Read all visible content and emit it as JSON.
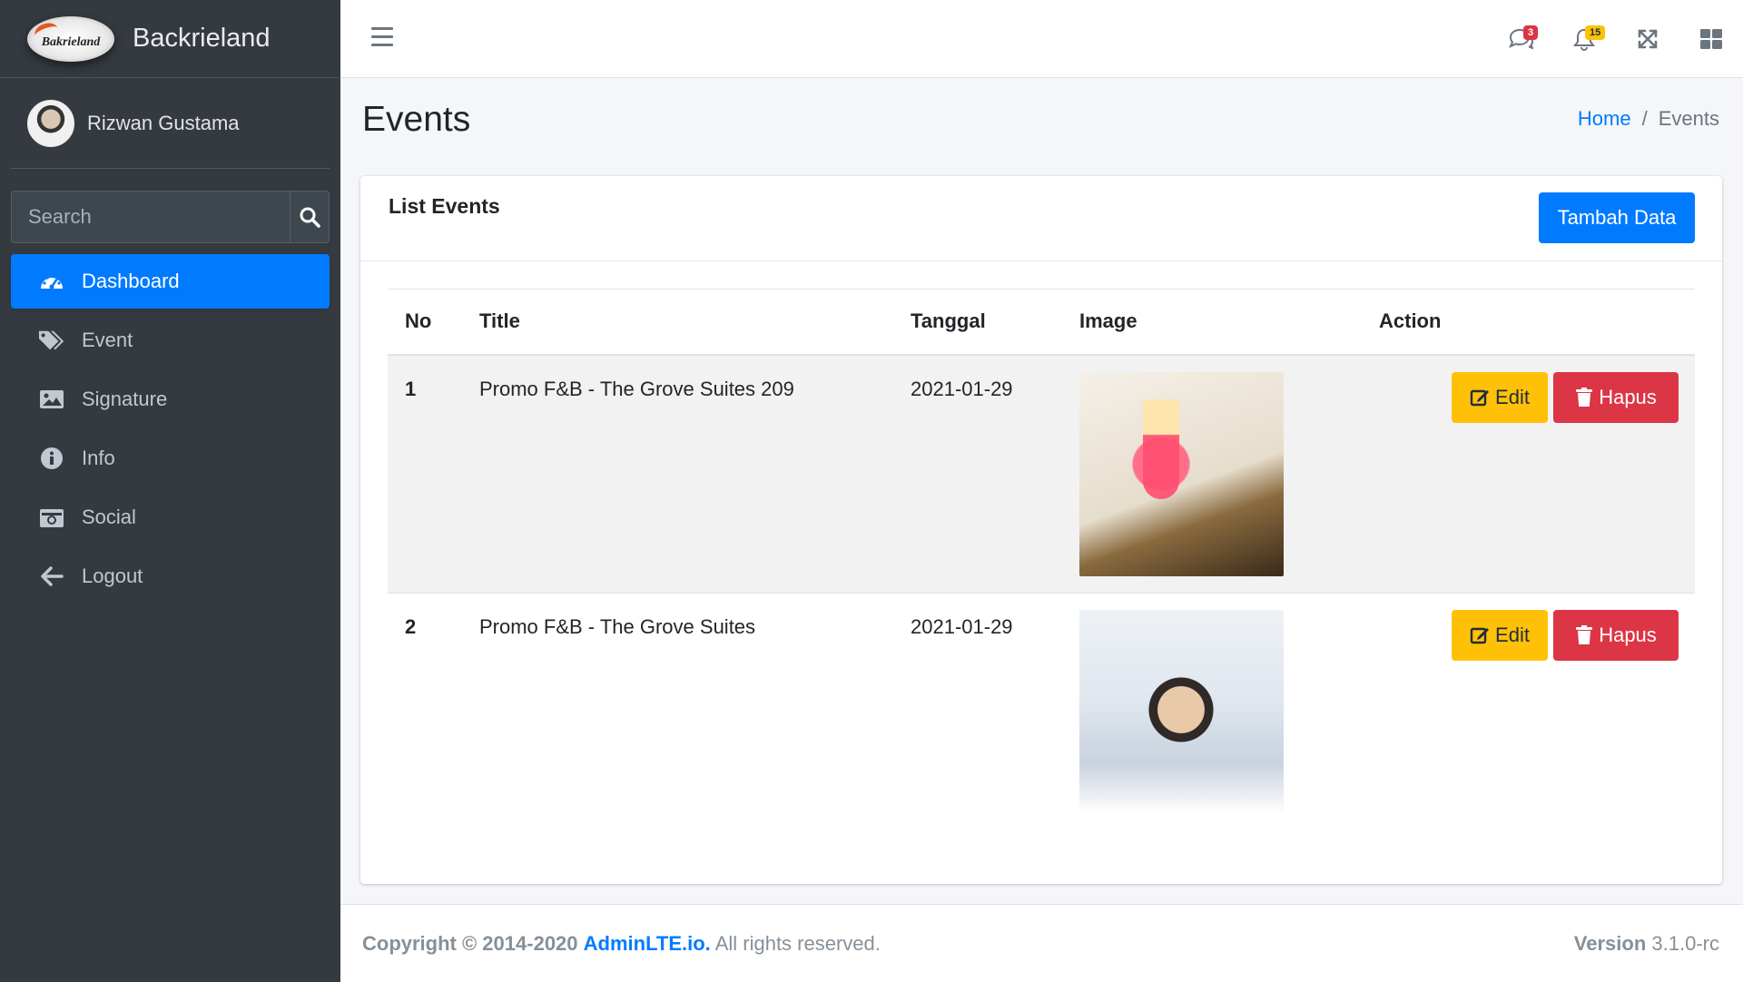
{
  "brand": {
    "logo_text": "Bakrieland",
    "name": "Backrieland"
  },
  "user": {
    "name": "Rizwan Gustama"
  },
  "search": {
    "placeholder": "Search"
  },
  "sidebar": {
    "items": [
      {
        "label": "Dashboard",
        "icon": "tachometer-icon",
        "active": true
      },
      {
        "label": "Event",
        "icon": "tags-icon"
      },
      {
        "label": "Signature",
        "icon": "image-icon"
      },
      {
        "label": "Info",
        "icon": "info-circle-icon"
      },
      {
        "label": "Social",
        "icon": "camera-icon"
      },
      {
        "label": "Logout",
        "icon": "arrow-left-icon"
      }
    ]
  },
  "topbar": {
    "messages_badge": "3",
    "notifications_badge": "15"
  },
  "page": {
    "title": "Events"
  },
  "breadcrumb": {
    "home": "Home",
    "separator": "/",
    "current": "Events"
  },
  "card": {
    "title": "List Events",
    "add_button": "Tambah Data"
  },
  "table": {
    "headers": {
      "no": "No",
      "title": "Title",
      "tanggal": "Tanggal",
      "image": "Image",
      "action": "Action"
    },
    "rows": [
      {
        "no": "1",
        "title": "Promo F&B - The Grove Suites 209",
        "tanggal": "2021-01-29",
        "image": "juju-queen-promo"
      },
      {
        "no": "2",
        "title": "Promo F&B - The Grove Suites",
        "tanggal": "2021-01-29",
        "image": "family-staycation-promo"
      }
    ],
    "edit_label": "Edit",
    "delete_label": "Hapus"
  },
  "footer": {
    "copyright": "Copyright © 2014-2020",
    "link": "AdminLTE.io.",
    "rights": "All rights reserved.",
    "version_label": "Version",
    "version": "3.1.0-rc"
  },
  "colors": {
    "primary": "#007bff",
    "warning": "#ffc107",
    "danger": "#dc3545",
    "sidebar": "#343a40"
  }
}
